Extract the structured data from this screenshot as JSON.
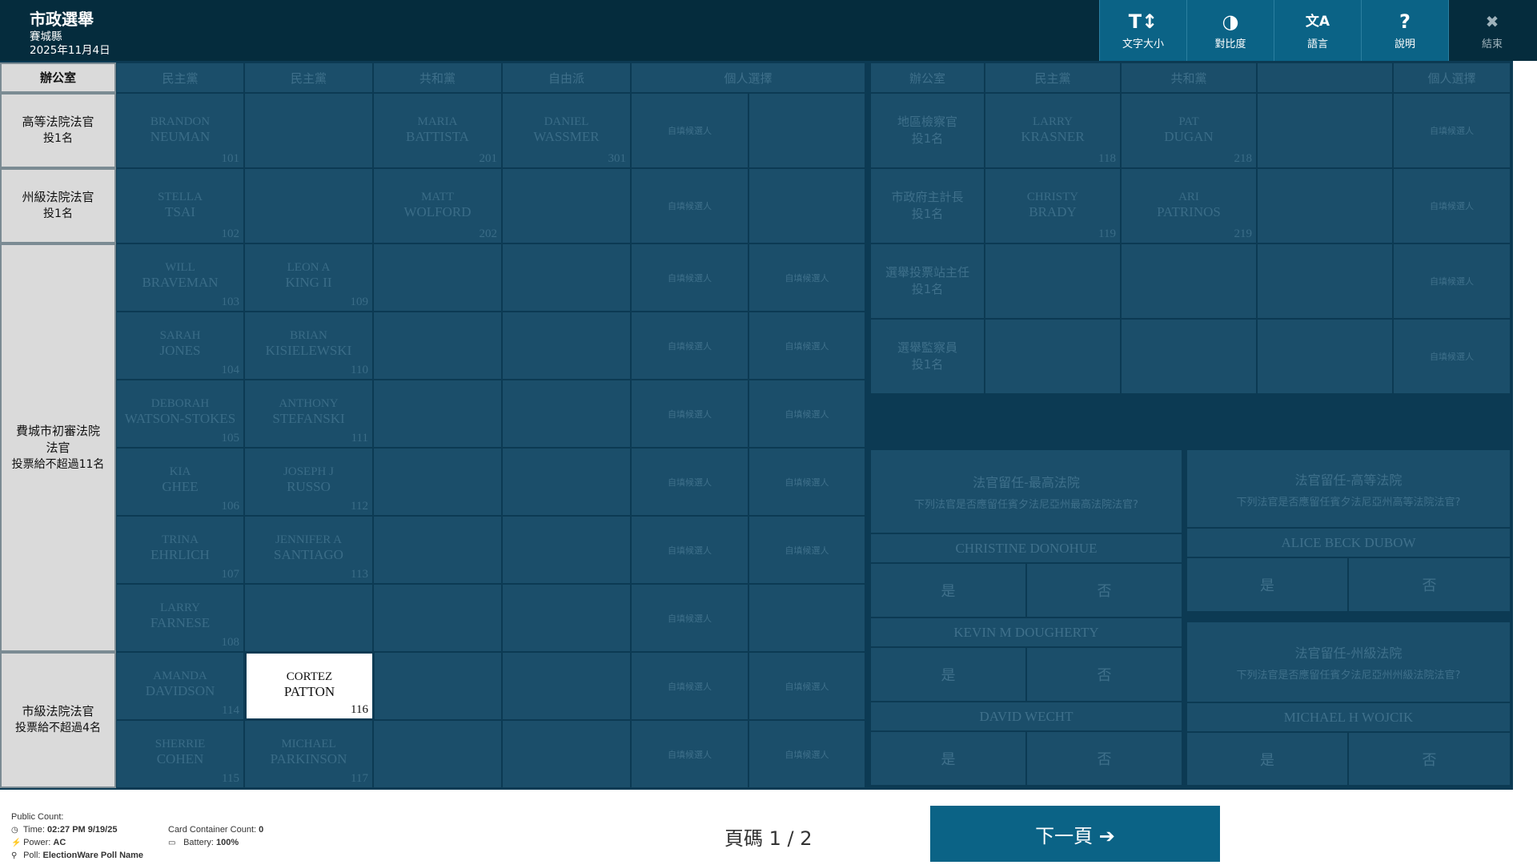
{
  "header": {
    "title": "市政選舉",
    "county": "賽城縣",
    "date": "2025年11月4日",
    "tools": [
      {
        "name": "text-size",
        "icon": "T↕",
        "label": "文字大小"
      },
      {
        "name": "contrast",
        "icon": "◑",
        "label": "對比度"
      },
      {
        "name": "language",
        "icon": "文A",
        "label": "語言"
      },
      {
        "name": "help",
        "icon": "?",
        "label": "說明"
      },
      {
        "name": "exit",
        "icon": "✖",
        "label": "結束"
      }
    ]
  },
  "ballot": {
    "left_headers": [
      "辦公室",
      "民主黨",
      "民主黨",
      "共和黨",
      "自由派",
      "個人選擇"
    ],
    "write_in": "自填候選人",
    "offices": {
      "superior": {
        "name": "高等法院法官",
        "rule": "投1名"
      },
      "commonwealth": {
        "name": "州級法院法官",
        "rule": "投1名"
      },
      "common_pleas": {
        "name": "費城市初審法院法官",
        "rule": "投票給不超過11名"
      },
      "municipal": {
        "name": "市級法院法官",
        "rule": "投票給不超過4名"
      }
    },
    "candidates": {
      "neuman": {
        "first": "BRANDON",
        "last": "NEUMAN",
        "num": "101"
      },
      "battista": {
        "first": "MARIA",
        "last": "BATTISTA",
        "num": "201"
      },
      "wassmer": {
        "first": "DANIEL",
        "last": "WASSMER",
        "num": "301"
      },
      "tsai": {
        "first": "STELLA",
        "last": "TSAI",
        "num": "102"
      },
      "wolford": {
        "first": "MATT",
        "last": "WOLFORD",
        "num": "202"
      },
      "braveman": {
        "first": "WILL",
        "last": "BRAVEMAN",
        "num": "103"
      },
      "king": {
        "first": "LEON A",
        "last": "KING II",
        "num": "109"
      },
      "jones": {
        "first": "SARAH",
        "last": "JONES",
        "num": "104"
      },
      "kisielewski": {
        "first": "BRIAN",
        "last": "KISIELEWSKI",
        "num": "110"
      },
      "watson": {
        "first": "DEBORAH",
        "last": "WATSON-STOKES",
        "num": "105"
      },
      "stefanski": {
        "first": "ANTHONY",
        "last": "STEFANSKI",
        "num": "111"
      },
      "ghee": {
        "first": "KIA",
        "last": "GHEE",
        "num": "106"
      },
      "russo": {
        "first": "JOSEPH J",
        "last": "RUSSO",
        "num": "112"
      },
      "ehrlich": {
        "first": "TRINA",
        "last": "EHRLICH",
        "num": "107"
      },
      "santiago": {
        "first": "JENNIFER A",
        "last": "SANTIAGO",
        "num": "113"
      },
      "farnese": {
        "first": "LARRY",
        "last": "FARNESE",
        "num": "108"
      },
      "davidson": {
        "first": "AMANDA",
        "last": "DAVIDSON",
        "num": "114"
      },
      "patton": {
        "first": "CORTEZ",
        "last": "PATTON",
        "num": "116"
      },
      "cohen": {
        "first": "SHERRIE",
        "last": "COHEN",
        "num": "115"
      },
      "parkinson": {
        "first": "MICHAEL",
        "last": "PARKINSON",
        "num": "117"
      },
      "krasner": {
        "first": "LARRY",
        "last": "KRASNER",
        "num": "118"
      },
      "dugan": {
        "first": "PAT",
        "last": "DUGAN",
        "num": "218"
      },
      "brady": {
        "first": "CHRISTY",
        "last": "BRADY",
        "num": "119"
      },
      "patrinos": {
        "first": "ARI",
        "last": "PATRINOS",
        "num": "219"
      }
    },
    "right_headers": [
      "辦公室",
      "民主黨",
      "共和黨",
      "",
      "個人選擇"
    ],
    "right_offices": {
      "da": {
        "name": "地區檢察官",
        "rule": "投1名"
      },
      "controller": {
        "name": "市政府主計長",
        "rule": "投1名"
      },
      "judge_elections": {
        "name": "選舉投票站主任",
        "rule": "投1名"
      },
      "inspector": {
        "name": "選舉監察員",
        "rule": "投1名"
      }
    },
    "retention": {
      "supreme": {
        "title": "法官留任-最高法院",
        "question": "下列法官是否應留任賓夕法尼亞州最高法院法官?"
      },
      "superior": {
        "title": "法官留任-高等法院",
        "question": "下列法官是否應留任賓夕法尼亞州高等法院法官?"
      },
      "commonwealth": {
        "title": "法官留任-州級法院",
        "question": "下列法官是否應留任賓夕法尼亞州州級法院法官?"
      },
      "yes": "是",
      "no": "否",
      "judges": {
        "donohue": "CHRISTINE DONOHUE",
        "dougherty": "KEVIN M DOUGHERTY",
        "wecht": "DAVID WECHT",
        "dubow": "ALICE BECK DUBOW",
        "wojcik": "MICHAEL H WOJCIK"
      }
    }
  },
  "footer": {
    "public_count_label": "Public Count:",
    "time_label": "Time:",
    "time_value": "02:27 PM 9/19/25",
    "power_label": "Power:",
    "power_value": "AC",
    "poll_label": "Poll:",
    "poll_value": "ElectionWare Poll Name",
    "card_label": "Card Container Count:",
    "card_value": "0",
    "battery_label": "Battery:",
    "battery_value": "100%",
    "page": "頁碼 1 / 2",
    "next_label": "下一頁 ➔"
  }
}
